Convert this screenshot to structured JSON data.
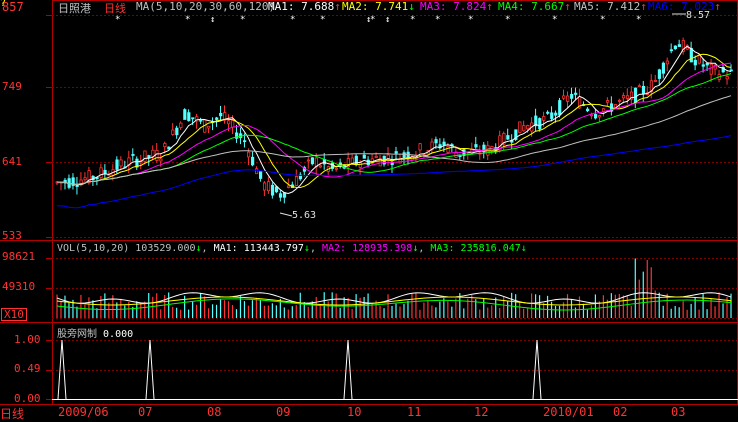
{
  "header": {
    "stock_name": "日照港",
    "period": "日线",
    "ma_title": "MA(5,10,20,30,60,120)",
    "ma_items": [
      {
        "label": "MA1:",
        "value": "7.688",
        "arrow": "↑",
        "color": "#ffffff"
      },
      {
        "label": "MA2:",
        "value": "7.741",
        "arrow": "↓",
        "color": "#ffff00"
      },
      {
        "label": "MA3:",
        "value": "7.824",
        "arrow": "↑",
        "color": "#ff00ff"
      },
      {
        "label": "MA4:",
        "value": "7.667",
        "arrow": "↑",
        "color": "#00ff00"
      },
      {
        "label": "MA5:",
        "value": "7.412",
        "arrow": "↑",
        "color": "#c0c0c0"
      },
      {
        "label": "MA6:",
        "value": "7.023",
        "arrow": "↑",
        "color": "#0000ff"
      }
    ]
  },
  "price_axis": {
    "top": "857",
    "t1": "749",
    "t2": "641",
    "bottom": "533"
  },
  "annotations": {
    "high": "8.57",
    "low": "5.63"
  },
  "vol_header": {
    "title": "VOL(5,10,20)",
    "vol": "103529.000",
    "vol_arrow": "↓",
    "ma1_label": "MA1:",
    "ma1": "113443.797",
    "ma1_arrow": "↓",
    "ma2_label": "MA2:",
    "ma2": "128935.398",
    "ma2_arrow": "↓",
    "ma3_label": "MA3:",
    "ma3": "235816.047",
    "ma3_arrow": "↓"
  },
  "vol_axis": {
    "top": "98621",
    "mid": "49310",
    "unit": "X10"
  },
  "ind_header": {
    "title": "股旁网制",
    "value": "0.000"
  },
  "ind_axis": {
    "top": "1.00",
    "mid": "0.49",
    "bottom": "0.00"
  },
  "date_axis": {
    "period_tab": "日线",
    "labels": [
      "2009/06",
      "07",
      "08",
      "09",
      "10",
      "11",
      "12",
      "2010/01",
      "02",
      "03"
    ]
  },
  "colors": {
    "up": "#ff3232",
    "down": "#54ffff",
    "grid": "#800000",
    "axis": "#b00000"
  }
}
